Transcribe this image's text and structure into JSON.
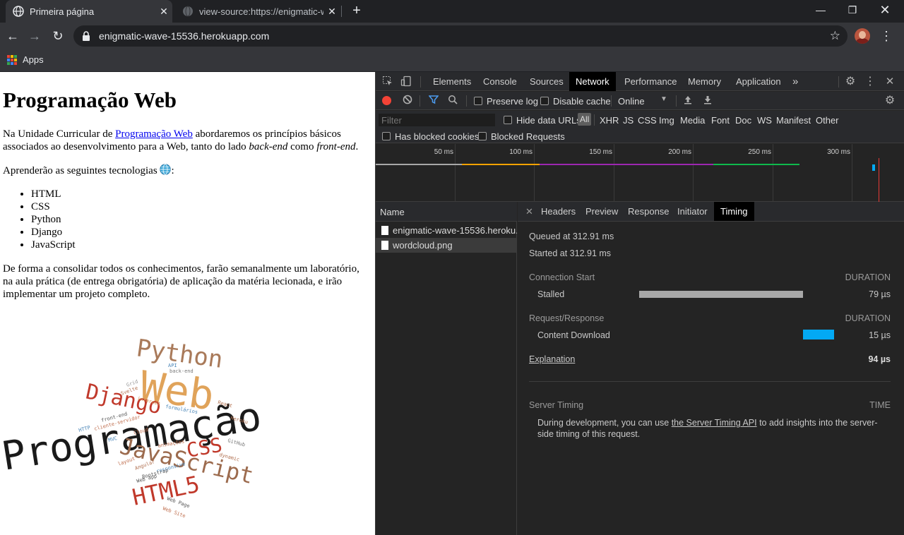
{
  "browser": {
    "tabs": [
      {
        "title": "Primeira página",
        "active": true
      },
      {
        "title": "view-source:https://enigmatic-wa",
        "active": false
      }
    ],
    "url": "enigmatic-wave-15536.herokuapp.com",
    "bookmarks": {
      "apps_label": "Apps"
    },
    "window_controls": [
      "minimize",
      "restore",
      "close"
    ]
  },
  "page": {
    "heading": "Programação Web",
    "intro": {
      "before_link": "Na Unidade Curricular de ",
      "link_text": "Programação Web",
      "after_link": " abordaremos os princípios básicos associados ao desenvolvimento para a Web, tanto do lado ",
      "em1": "back-end",
      "middle": " como ",
      "em2": "front-end",
      "end": "."
    },
    "tech_intro_before": "Aprenderão as seguintes tecnologias ",
    "tech_intro_after": ":",
    "technologies": [
      "HTML",
      "CSS",
      "Python",
      "Django",
      "JavaScript"
    ],
    "closing": "De forma a consolidar todos os conhecimentos, farão semanalmente um laboratório, na aula prática (de entrega obrigatória) de aplicação da matéria lecionada, e irão implementar um projeto completo.",
    "wordcloud": {
      "big": [
        {
          "text": "Programação",
          "color": "#1a1a1a"
        },
        {
          "text": "Web",
          "color": "#e0a35a"
        },
        {
          "text": "Python",
          "color": "#a97a5a"
        },
        {
          "text": "Django",
          "color": "#c0392b"
        },
        {
          "text": "JavaScript",
          "color": "#9c6b4e"
        },
        {
          "text": "CSS",
          "color": "#c0392b"
        },
        {
          "text": "HTML5",
          "color": "#c0392b"
        }
      ],
      "small": [
        "API",
        "back-end",
        "Grid",
        "Svelte",
        "internet",
        "formulários",
        "React",
        "HTTP",
        "front-end",
        "cliente-servidor",
        "Heroku",
        "Cloud",
        "MVC",
        "animações",
        "GitHub",
        "Angular",
        "dynamic",
        "layout",
        "responsive",
        "Web app",
        "Bootstrap",
        "Web Page",
        "Web Site"
      ]
    }
  },
  "devtools": {
    "panels": [
      "Elements",
      "Console",
      "Sources",
      "Network",
      "Performance",
      "Memory",
      "Application"
    ],
    "active_panel": "Network",
    "more_panels": "»",
    "toolbar": {
      "preserve_log": "Preserve log",
      "disable_cache": "Disable cache",
      "throttling": "Online"
    },
    "filter": {
      "placeholder": "Filter",
      "hide_data_urls": "Hide data URLs",
      "all": "All",
      "types": [
        "XHR",
        "JS",
        "CSS",
        "Img",
        "Media",
        "Font",
        "Doc",
        "WS",
        "Manifest",
        "Other"
      ],
      "has_blocked_cookies": "Has blocked cookies",
      "blocked_requests": "Blocked Requests"
    },
    "overview_ticks": [
      "50 ms",
      "100 ms",
      "150 ms",
      "200 ms",
      "250 ms",
      "300 ms"
    ],
    "requests": {
      "header": "Name",
      "items": [
        "enigmatic-wave-15536.heroku...",
        "wordcloud.png"
      ]
    },
    "detail_tabs": [
      "Headers",
      "Preview",
      "Response",
      "Initiator",
      "Timing"
    ],
    "active_detail_tab": "Timing",
    "timing": {
      "queued": "Queued at 312.91 ms",
      "started": "Started at 312.91 ms",
      "connection_start": "Connection Start",
      "duration_label": "DURATION",
      "stalled_label": "Stalled",
      "stalled_value": "79 µs",
      "request_response": "Request/Response",
      "content_download_label": "Content Download",
      "content_download_value": "15 µs",
      "explanation": "Explanation",
      "total": "94 µs",
      "server_timing": "Server Timing",
      "time_label": "TIME",
      "server_note_before": "During development, you can use ",
      "server_note_link": "the Server Timing API",
      "server_note_after": " to add insights into the server-side timing of this request."
    },
    "colors": {
      "stalled": "#a8a8a8",
      "download": "#03a9f4",
      "active_tab_bg": "#000000"
    }
  }
}
